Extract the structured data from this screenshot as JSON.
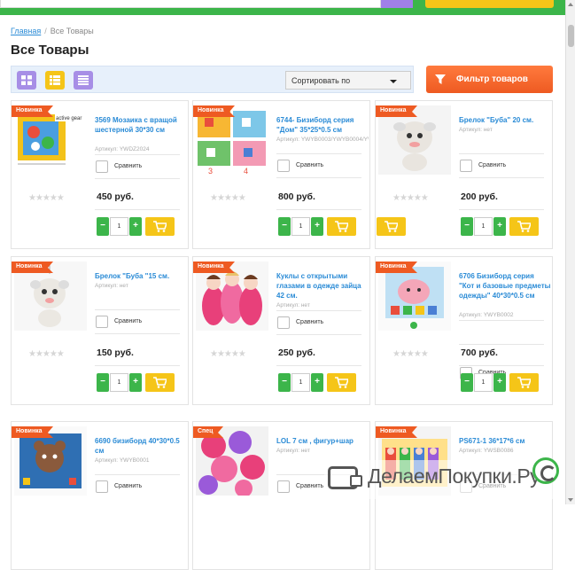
{
  "breadcrumb": {
    "home": "Главная",
    "current": "Все Товары"
  },
  "page_title": "Все Товары",
  "toolbar": {
    "sort_label": "Сортировать по",
    "filter_label": "Фильтр товаров"
  },
  "products": [
    {
      "badge": "Новинка",
      "name": "3569 Мозаика с вращой шестерной 30*30 см",
      "article": "Артикул: YWDZ2024",
      "compare": "Сравнить",
      "price": "450 руб.",
      "qty": "1"
    },
    {
      "badge": "Новинка",
      "name": "6744- Бизиборд серия \"Дом\" 35*25*0.5 см",
      "article": "Артикул: YWYB0003/YWYB0004/YWYB0005/...",
      "compare": "Сравнить",
      "price": "800 руб.",
      "qty": "1"
    },
    {
      "badge": "Новинка",
      "name": "Брелок \"Буба\" 20 см.",
      "article": "Артикул: нет",
      "compare": "Сравнить",
      "price": "200 руб.",
      "qty": "1"
    },
    {
      "badge": "Новинка",
      "name": "Брелок \"Буба \"15 см.",
      "article": "Артикул: нет",
      "compare": "Сравнить",
      "price": "150 руб.",
      "qty": "1"
    },
    {
      "badge": "Новинка",
      "name": "Куклы с открытыми глазами в одежде зайца 42 см.",
      "article": "Артикул: нет",
      "compare": "Сравнить",
      "price": "250 руб.",
      "qty": "1"
    },
    {
      "badge": "Новинка",
      "name": "6706 Бизиборд серия \"Кот и базовые предметы одежды\" 40*30*0.5 см",
      "article": "Артикул: YWYB0002",
      "compare": "Сравнить",
      "price": "700 руб.",
      "qty": "1"
    },
    {
      "badge": "Новинка",
      "name": "6690 бизиборд 40*30*0.5 см",
      "article": "Артикул: YWYB0001",
      "compare": "Сравнить"
    },
    {
      "badge": "Спец",
      "name": "LOL 7 см , фигур+шар",
      "article": "Артикул: нет",
      "compare": "Сравнить"
    },
    {
      "badge": "Новинка",
      "name": "PS671-1 36*17*6 см",
      "article": "Артикул: YWSB0086",
      "compare": "Сравнить"
    }
  ],
  "stars": "★★★★★",
  "watermark": "ДелаемПокупки.Ру",
  "colors": {
    "accent_green": "#3cb54a",
    "link_blue": "#2a8bd6",
    "badge_orange": "#ee5a22",
    "cart_yellow": "#f5c518",
    "view_purple": "#a78ee6"
  }
}
